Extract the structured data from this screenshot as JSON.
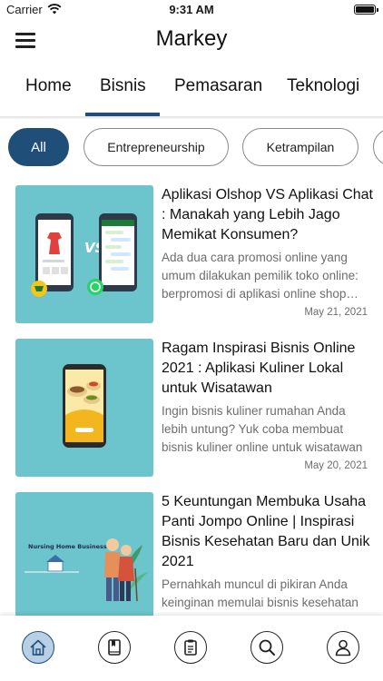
{
  "status": {
    "carrier": "Carrier",
    "time": "9:31 AM"
  },
  "header": {
    "title": "Markey"
  },
  "tabs": [
    {
      "label": "Home"
    },
    {
      "label": "Bisnis"
    },
    {
      "label": "Pemasaran"
    },
    {
      "label": "Teknologi"
    }
  ],
  "chips": [
    {
      "label": "All"
    },
    {
      "label": "Entrepreneurship"
    },
    {
      "label": "Ketrampilan"
    },
    {
      "label": ""
    }
  ],
  "articles": [
    {
      "title": "Aplikasi Olshop VS Aplikasi Chat : Manakah yang Lebih Jago Memikat Konsumen?",
      "excerpt": "Ada dua cara promosi online yang umum dilakukan pemilik toko online: berpromosi di aplikasi online shop ataupun aplikasi chat",
      "date": "May 21, 2021",
      "image_text": "VS"
    },
    {
      "title": "Ragam Inspirasi Bisnis Online 2021 : Aplikasi Kuliner Lokal untuk Wisatawan",
      "excerpt": "Ingin bisnis kuliner rumahan Anda lebih untung? Yuk coba membuat bisnis kuliner online untuk wisatawan",
      "date": "May 20, 2021",
      "image_text": ""
    },
    {
      "title": "5 Keuntungan Membuka Usaha Panti Jompo Online | Inspirasi Bisnis Kesehatan Baru dan Unik 2021",
      "excerpt": "Pernahkah muncul di pikiran Anda keinginan memulai bisnis kesehatan",
      "date": "",
      "image_text": "Nursing Home Business"
    }
  ],
  "bottom_nav": [
    "home-icon",
    "book-icon",
    "clipboard-icon",
    "search-icon",
    "user-icon"
  ],
  "colors": {
    "accent": "#1f4e79",
    "thumb_bg": "#6cc5cd",
    "active_nav_bg": "#b9cfe6"
  }
}
